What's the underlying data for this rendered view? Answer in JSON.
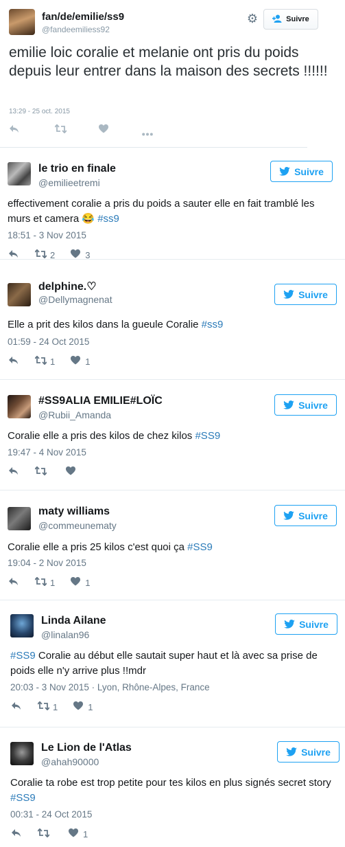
{
  "main_tweet": {
    "name": "fan/de/emilie/ss9",
    "handle": "@fandeemiliess92",
    "follow_label": "Suivre",
    "text": "emilie loic coralie et melanie ont pris du poids depuis leur entrer dans la maison des secrets !!!!!!",
    "time": "13:29 - 25 oct. 2015"
  },
  "replies": [
    {
      "name": "le trio en finale",
      "handle": "@emilieetremi",
      "follow_label": "Suivre",
      "text_before": "effectivement coralie a pris du poids a sauter elle en fait tramblé les murs et camera 😂 ",
      "hashtag": "#ss9",
      "text_after": "",
      "time": "18:51 - 3 Nov 2015",
      "retweets": "2",
      "likes": "3"
    },
    {
      "name": "delphine.♡",
      "handle": "@Dellymagnenat",
      "follow_label": "Suivre",
      "text_before": "Elle a prit des kilos dans la gueule Coralie ",
      "hashtag": "#ss9",
      "text_after": "",
      "time": "01:59 - 24 Oct 2015",
      "retweets": "1",
      "likes": "1"
    },
    {
      "name": "#SS9ALIA EMILIE#LOÏC",
      "handle": "@Rubii_Amanda",
      "follow_label": "Suivre",
      "text_before": "Coralie elle a pris des kilos de chez kilos  ",
      "hashtag": "#SS9",
      "text_after": "",
      "time": "19:47 - 4 Nov 2015",
      "retweets": "",
      "likes": ""
    },
    {
      "name": "maty williams",
      "handle": "@commeunematy",
      "follow_label": "Suivre",
      "text_before": "Coralie elle a pris 25 kilos c'est quoi ça ",
      "hashtag": "#SS9",
      "text_after": "",
      "time": "19:04 - 2 Nov 2015",
      "retweets": "1",
      "likes": "1"
    },
    {
      "name": "Linda Ailane",
      "handle": "@linalan96",
      "follow_label": "Suivre",
      "text_before": "",
      "hashtag": "#SS9",
      "text_after": " Coralie au début elle sautait super haut et là avec sa prise de poids elle n'y arrive plus !!mdr",
      "time": "20:03 - 3 Nov 2015 · Lyon, Rhône-Alpes, France",
      "retweets": "1",
      "likes": "1"
    },
    {
      "name": "Le Lion de l'Atlas",
      "handle": "@ahah90000",
      "follow_label": "Suivre",
      "text_before": "Coralie ta robe est trop petite pour tes kilos en plus signés secret story ",
      "hashtag": "#SS9",
      "text_after": "",
      "time": "00:31 - 24 Oct 2015",
      "retweets": "",
      "likes": "1"
    }
  ],
  "icons": {
    "reply": "reply-icon",
    "retweet": "retweet-icon",
    "like": "heart-icon",
    "more": "more-icon",
    "gear": "gear-icon",
    "bird": "twitter-bird-icon"
  },
  "colors": {
    "accent": "#1da1f2",
    "hashtag": "#2b7bb9",
    "muted": "#657786"
  }
}
